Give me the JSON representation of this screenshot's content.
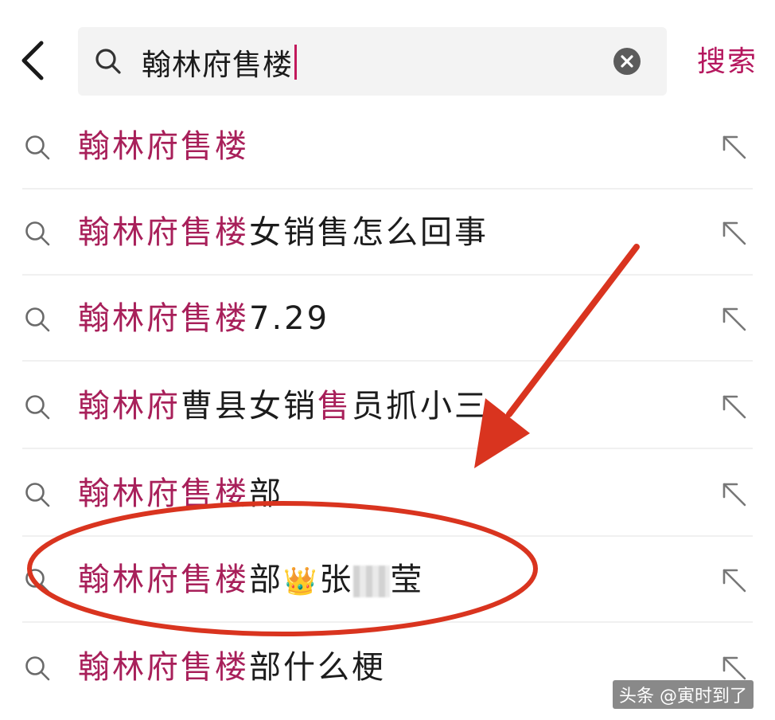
{
  "search": {
    "query": "翰林府售楼",
    "button_label": "搜索"
  },
  "suggestions": [
    {
      "hl": "翰林府售楼",
      "rest": ""
    },
    {
      "hl": "翰林府售楼",
      "rest": "女销售怎么回事"
    },
    {
      "hl": "翰林府售楼",
      "rest": "7.29"
    },
    {
      "hl": "翰林府",
      "mid": "曹县女销",
      "hl2": "售",
      "rest": "员抓小三"
    },
    {
      "hl": "翰林府售楼",
      "rest": "部"
    },
    {
      "hl": "翰林府售楼",
      "rest": "部",
      "emoji": "👑",
      "tail1": "张",
      "tail2": "莹"
    },
    {
      "hl": "翰林府售楼",
      "rest": "部什么梗"
    }
  ],
  "watermark": "头条 @寅时到了",
  "colors": {
    "accent": "#b5175e",
    "highlight": "#a8205a",
    "annotation": "#d9341f"
  }
}
